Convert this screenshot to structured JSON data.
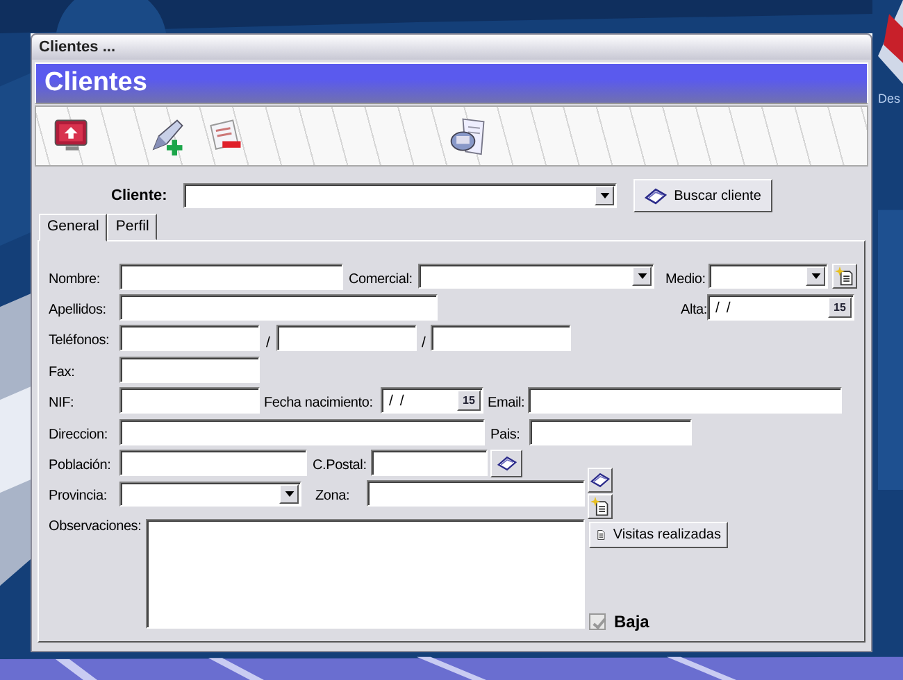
{
  "desktop": {
    "icon_label": "Des"
  },
  "window": {
    "title": "Clientes ...",
    "header": "Clientes"
  },
  "search": {
    "label": "Cliente:",
    "button": "Buscar cliente"
  },
  "tabs": [
    {
      "label": "General",
      "selected": true
    },
    {
      "label": "Perfil",
      "selected": false
    }
  ],
  "form": {
    "nombre": {
      "label": "Nombre:"
    },
    "comercial": {
      "label": "Comercial:"
    },
    "medio": {
      "label": "Medio:"
    },
    "apellidos": {
      "label": "Apellidos:"
    },
    "alta": {
      "label": "Alta:",
      "value": "/ /",
      "calendar": "15"
    },
    "telefonos": {
      "label": "Teléfonos:",
      "separators": [
        "/",
        "/"
      ]
    },
    "fax": {
      "label": "Fax:"
    },
    "nif": {
      "label": "NIF:"
    },
    "fecha_nacimiento": {
      "label": "Fecha nacimiento:",
      "value": "/ /",
      "calendar": "15"
    },
    "email": {
      "label": "Email:"
    },
    "direccion": {
      "label": "Direccion:"
    },
    "pais": {
      "label": "Pais:"
    },
    "poblacion": {
      "label": "Población:"
    },
    "codigo_postal": {
      "label": "C.Postal:"
    },
    "provincia": {
      "label": "Provincia:"
    },
    "zona": {
      "label": "Zona:"
    },
    "observaciones": {
      "label": "Observaciones:"
    }
  },
  "visits_button": "Visitas realizadas",
  "baja": {
    "label": "Baja",
    "checked": true,
    "disabled": true
  }
}
